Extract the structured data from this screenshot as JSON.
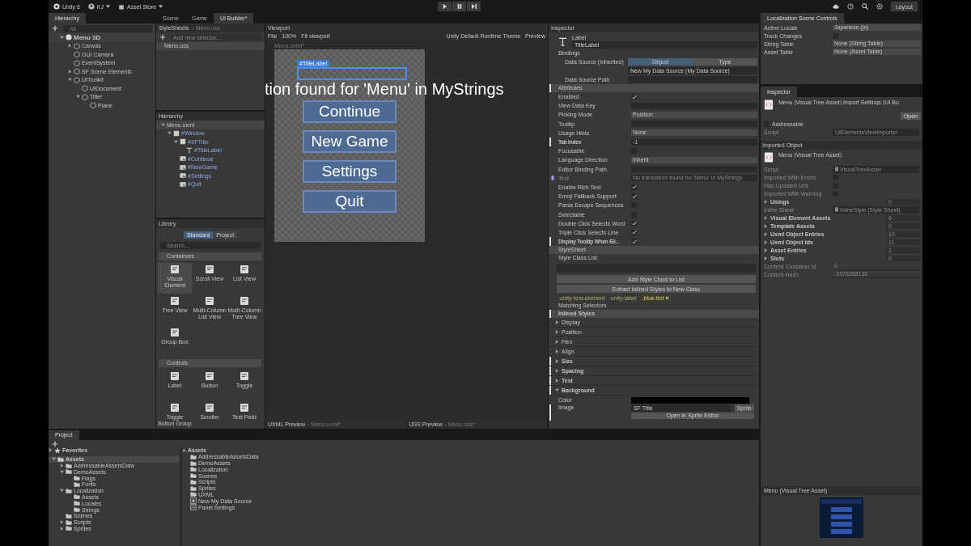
{
  "toolbar": {
    "product": "Unity 6",
    "account": "KJ",
    "store": "Asset Store",
    "layout": "Layout"
  },
  "hierarchy": {
    "title": "Hierarchy",
    "search": "All",
    "tree": [
      {
        "name": "Menu 3D",
        "kind": "scene",
        "expanded": true,
        "children": [
          {
            "name": "Canvas",
            "kind": "object",
            "expanded": false
          },
          {
            "name": "GUI Camera",
            "kind": "object"
          },
          {
            "name": "EventSystem",
            "kind": "object"
          },
          {
            "name": "SF Scene Elements",
            "kind": "object",
            "expanded": false
          },
          {
            "name": "UIToolkit",
            "kind": "object",
            "expanded": true,
            "children": [
              {
                "name": "UIDocument",
                "kind": "object"
              },
              {
                "name": "Tilter",
                "kind": "object",
                "expanded": true,
                "children": [
                  {
                    "name": "Plane",
                    "kind": "object"
                  }
                ]
              }
            ]
          }
        ]
      }
    ]
  },
  "tabs": [
    {
      "label": "Scene",
      "selected": false
    },
    {
      "label": "Game",
      "selected": false
    },
    {
      "label": "UI Builder*",
      "selected": true
    }
  ],
  "stylesheets": {
    "title": "StyleSheets",
    "file": "- Menu.uss",
    "placeholder": "Add new selector...",
    "items": [
      "Menu.uss"
    ]
  },
  "builder_hierarchy": {
    "title": "Hierarchy",
    "tree": [
      {
        "name": "Menu.uxml",
        "kind": "document",
        "expanded": true,
        "children": [
          {
            "name": "#Window",
            "kind": "element",
            "expanded": true,
            "children": [
              {
                "name": "#SFTitle",
                "kind": "element",
                "expanded": true,
                "children": [
                  {
                    "name": "#TitleLabel",
                    "kind": "label"
                  }
                ]
              },
              {
                "name": "#Continue",
                "kind": "button"
              },
              {
                "name": "#NewGame",
                "kind": "button"
              },
              {
                "name": "#Settings",
                "kind": "button"
              },
              {
                "name": "#Quit",
                "kind": "button"
              }
            ]
          }
        ]
      }
    ]
  },
  "library": {
    "title": "Library",
    "tabs": [
      {
        "label": "Standard",
        "selected": true
      },
      {
        "label": "Project",
        "selected": false
      }
    ],
    "placeholder": "Search...",
    "sections": [
      {
        "title": "Containers",
        "items": [
          {
            "label": "Visual Element",
            "selected": true
          },
          {
            "label": "Scroll View",
            "selected": false
          },
          {
            "label": "List View",
            "selected": false
          },
          {
            "label": "Tree View",
            "selected": false
          },
          {
            "label": "Multi-Column List View",
            "selected": false
          },
          {
            "label": "Multi-Column Tree View",
            "selected": false
          },
          {
            "label": "Group Box",
            "selected": false
          }
        ]
      },
      {
        "title": "Controls",
        "items": [
          {
            "label": "Label",
            "selected": false
          },
          {
            "label": "Button",
            "selected": false
          },
          {
            "label": "Toggle",
            "selected": false
          },
          {
            "label": "Toggle Button Group",
            "selected": false
          },
          {
            "label": "Scroller",
            "selected": false
          },
          {
            "label": "Text Field",
            "selected": false
          }
        ]
      }
    ]
  },
  "viewport": {
    "title": "Viewport",
    "menu": [
      "File",
      "100%"
    ],
    "fit": "Fit viewport",
    "theme": "Unity Default Runtime Theme",
    "preview": "Preview",
    "canvas_title": "Menu.uxml*",
    "selection_tag": "#TitleLabel",
    "heading": "tion found for 'Menu' in MyStrings",
    "buttons": [
      "Continue",
      "New Game",
      "Settings",
      "Quit"
    ],
    "footer": [
      {
        "label": "UXML Preview",
        "file": "- Menu.uxml*"
      },
      {
        "label": "USS Preview",
        "file": "- Menu.uss*"
      }
    ]
  },
  "inspector": {
    "title": "Inspector",
    "type": "Label",
    "name": "TitleLabel",
    "bindings": {
      "title": "Bindings",
      "source_label": "Data Source (Inherited)",
      "modes": [
        {
          "label": "Object",
          "selected": true
        },
        {
          "label": "Type",
          "selected": false
        }
      ],
      "source": "New My Data Source (My Data Source)",
      "path_label": "Data Source Path"
    },
    "attributes_title": "Attributes",
    "attributes": [
      {
        "label": "Enabled",
        "kind": "check",
        "checked": true,
        "overridden": false,
        "bound": false
      },
      {
        "label": "View Data Key",
        "kind": "text",
        "overridden": false,
        "bound": false
      },
      {
        "label": "Picking Mode",
        "kind": "dropdown",
        "value": "Position",
        "overridden": false,
        "bound": false
      },
      {
        "label": "Tooltip",
        "kind": "text",
        "overridden": false,
        "bound": false
      },
      {
        "label": "Usage Hints",
        "kind": "dropdown",
        "value": "None",
        "overridden": false,
        "bound": false
      },
      {
        "label": "Tab Index",
        "kind": "text",
        "value": "-1",
        "overridden": true,
        "bound": false
      },
      {
        "label": "Focusable",
        "kind": "check",
        "checked": false,
        "overridden": false,
        "bound": false
      },
      {
        "label": "Language Direction",
        "kind": "dropdown",
        "value": "Inherit",
        "overridden": false,
        "bound": false
      },
      {
        "label": "Editor Binding Path",
        "kind": "text",
        "overridden": false,
        "bound": false
      },
      {
        "label": "Text",
        "kind": "text",
        "value": "No translation found for 'Menu' in MyStrings",
        "overridden": false,
        "bound": true
      },
      {
        "label": "Enable Rich Text",
        "kind": "check",
        "checked": true,
        "overridden": false,
        "bound": false
      },
      {
        "label": "Emoji Fallback Support",
        "kind": "check",
        "checked": true,
        "overridden": false,
        "bound": false
      },
      {
        "label": "Parse Escape Sequences",
        "kind": "check",
        "checked": false,
        "overridden": false,
        "bound": false
      },
      {
        "label": "Selectable",
        "kind": "check",
        "checked": false,
        "overridden": false,
        "bound": false
      },
      {
        "label": "Double Click Selects Word",
        "kind": "check",
        "checked": true,
        "overridden": false,
        "bound": false
      },
      {
        "label": "Triple Click Selects Line",
        "kind": "check",
        "checked": true,
        "overridden": false,
        "bound": false
      },
      {
        "label": "Display Tooltip When Eli...",
        "kind": "check",
        "checked": true,
        "overridden": true,
        "bound": false
      }
    ],
    "stylesheet_title": "StyleSheet",
    "class_list_title": "Style Class List",
    "class_buttons": [
      "Add Style Class to List",
      "Extract Inlined Styles to New Class"
    ],
    "classes": [
      {
        "label": "unity-text-element",
        "removable": false
      },
      {
        "label": "unity-label",
        "removable": false
      },
      {
        "label": ".blue-tint",
        "removable": true
      }
    ],
    "matching_title": "Matching Selectors",
    "inlined_title": "Inlined Styles",
    "style_sections": [
      {
        "label": "Display",
        "overridden": false,
        "expanded": false
      },
      {
        "label": "Position",
        "overridden": false,
        "expanded": false
      },
      {
        "label": "Flex",
        "overridden": false,
        "expanded": false
      },
      {
        "label": "Align",
        "overridden": false,
        "expanded": false
      },
      {
        "label": "Size",
        "overridden": true,
        "expanded": false
      },
      {
        "label": "Spacing",
        "overridden": true,
        "expanded": false
      },
      {
        "label": "Text",
        "overridden": true,
        "expanded": false
      },
      {
        "label": "Background",
        "overridden": true,
        "expanded": true
      }
    ],
    "background": {
      "color_label": "Color",
      "color": "#000000",
      "image_label": "Image",
      "image": "SF Title",
      "image_type": "Sprite",
      "sprite_button": "Open in Sprite Editor"
    }
  },
  "localization": {
    "title": "Localization Scene Controls",
    "fields": [
      {
        "label": "Active Locale",
        "kind": "dropdown",
        "value": "Japanese (ja)"
      },
      {
        "label": "Track Changes",
        "kind": "check",
        "checked": false
      },
      {
        "label": "String Table",
        "kind": "dropdown",
        "value": "None (String Table)"
      },
      {
        "label": "Asset Table",
        "kind": "dropdown",
        "value": "None (Asset Table)"
      }
    ]
  },
  "asset_inspector": {
    "title": "Inspector",
    "header": "Menu (Visual Tree Asset) Import Settings (UI Bu",
    "open": "Open",
    "addressable": {
      "label": "Addressable",
      "checked": false
    },
    "script_label": "Script",
    "script": "UIElementsViewImporter",
    "imported_title": "Imported Object",
    "object": "Menu (Visual Tree Asset)",
    "fields": [
      {
        "label": "Script",
        "kind": "object",
        "value": "VisualTreeAsset"
      },
      {
        "label": "Imported With Errors",
        "kind": "check",
        "checked": false
      },
      {
        "label": "Has Updated Urls",
        "kind": "check",
        "checked": false
      },
      {
        "label": "Imported With Warning",
        "kind": "check",
        "checked": false
      },
      {
        "label": "Usings",
        "kind": "foldout",
        "value": "0"
      },
      {
        "label": "Inline Sheet",
        "kind": "object",
        "value": "InlineStyle (Style Sheet)"
      },
      {
        "label": "Visual Element Assets",
        "kind": "foldout",
        "value": "6"
      },
      {
        "label": "Template Assets",
        "kind": "foldout",
        "value": "0"
      },
      {
        "label": "Uxml Object Entries",
        "kind": "foldout",
        "value": "10"
      },
      {
        "label": "Uxml Object Ids",
        "kind": "foldout",
        "value": "11"
      },
      {
        "label": "Asset Entries",
        "kind": "foldout",
        "value": "1"
      },
      {
        "label": "Slots",
        "kind": "foldout",
        "value": "0"
      },
      {
        "label": "Content Container Id",
        "kind": "number",
        "value": "0"
      },
      {
        "label": "Content Hash",
        "kind": "number",
        "value": "-1976288136"
      }
    ],
    "preview_title": "Menu (Visual Tree Asset)"
  },
  "project": {
    "title": "Project",
    "favorites": "Favorites",
    "tree": [
      {
        "name": "Assets",
        "expanded": true,
        "selected": true,
        "children": [
          {
            "name": "AddressableAssetsData",
            "expanded": false,
            "selected": false
          },
          {
            "name": "DemoAssets",
            "expanded": true,
            "selected": false,
            "children": [
              {
                "name": "Flags",
                "selected": false
              },
              {
                "name": "Fonts",
                "selected": false
              }
            ]
          },
          {
            "name": "Localization",
            "expanded": true,
            "selected": false,
            "children": [
              {
                "name": "Assets",
                "selected": false
              },
              {
                "name": "Locales",
                "selected": false
              },
              {
                "name": "Strings",
                "selected": false
              }
            ]
          },
          {
            "name": "Scenes",
            "selected": false
          },
          {
            "name": "Scripts",
            "expanded": false,
            "selected": false
          },
          {
            "name": "Sprites",
            "expanded": false,
            "selected": false
          }
        ]
      }
    ],
    "list_title": "Assets",
    "items": [
      {
        "name": "AddressableAssetsData",
        "kind": "folder"
      },
      {
        "name": "DemoAssets",
        "kind": "folder"
      },
      {
        "name": "Localization",
        "kind": "folder"
      },
      {
        "name": "Scenes",
        "kind": "folder"
      },
      {
        "name": "Scripts",
        "kind": "folder"
      },
      {
        "name": "Sprites",
        "kind": "folder"
      },
      {
        "name": "UXML",
        "kind": "folder"
      },
      {
        "name": "New My Data Source",
        "kind": "asset"
      },
      {
        "name": "Panel Settings",
        "kind": "settings"
      }
    ]
  }
}
